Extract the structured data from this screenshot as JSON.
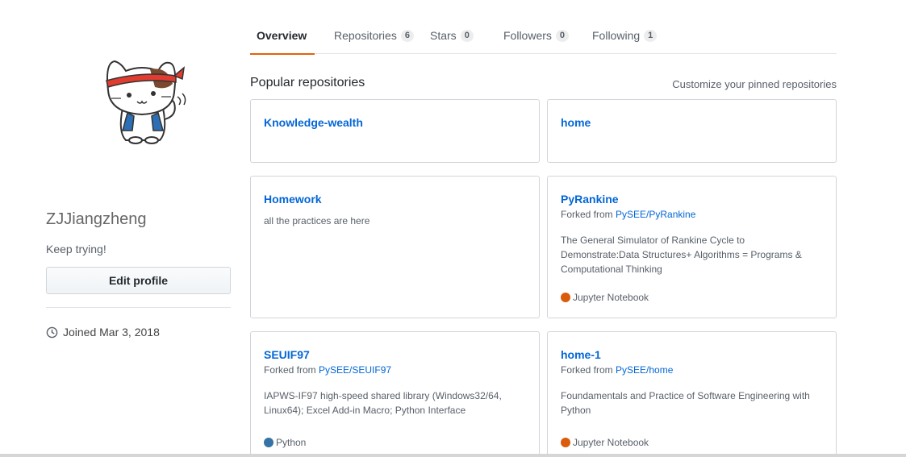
{
  "profile": {
    "username": "ZJJiangzheng",
    "bio": "Keep trying!",
    "edit_button": "Edit profile",
    "joined": "Joined Mar 3, 2018",
    "avatar_icon": "cat-avatar-icon"
  },
  "tabs": [
    {
      "label": "Overview",
      "count": null,
      "selected": true
    },
    {
      "label": "Repositories",
      "count": "6",
      "selected": false
    },
    {
      "label": "Stars",
      "count": "0",
      "selected": false
    },
    {
      "label": "Followers",
      "count": "0",
      "selected": false
    },
    {
      "label": "Following",
      "count": "1",
      "selected": false
    }
  ],
  "popular": {
    "title": "Popular repositories",
    "customize": "Customize your pinned repositories"
  },
  "repos": [
    {
      "name": "Knowledge-wealth"
    },
    {
      "name": "home"
    },
    {
      "name": "Homework",
      "description": "all the practices are here"
    },
    {
      "name": "PyRankine",
      "forked_prefix": "Forked from ",
      "forked_from": "PySEE/PyRankine",
      "description": "The General Simulator of Rankine Cycle to Demonstrate:Data Structures+ Algorithms = Programs & Computational Thinking",
      "language": "Jupyter Notebook",
      "language_color": "#DA5B0B"
    },
    {
      "name": "SEUIF97",
      "forked_prefix": "Forked from ",
      "forked_from": "PySEE/SEUIF97",
      "description": "IAPWS-IF97 high-speed shared library (Windows32/64, Linux64); Excel Add-in Macro; Python Interface",
      "language": "Python",
      "language_color": "#3572A5"
    },
    {
      "name": "home-1",
      "forked_prefix": "Forked from ",
      "forked_from": "PySEE/home",
      "description": "Foundamentals and Practice of Software Engineering with Python",
      "language": "Jupyter Notebook",
      "language_color": "#DA5B0B"
    }
  ],
  "colors": {
    "accent": "#e36209",
    "link": "#0366d6",
    "jupyter": "#DA5B0B",
    "python": "#3572A5"
  }
}
